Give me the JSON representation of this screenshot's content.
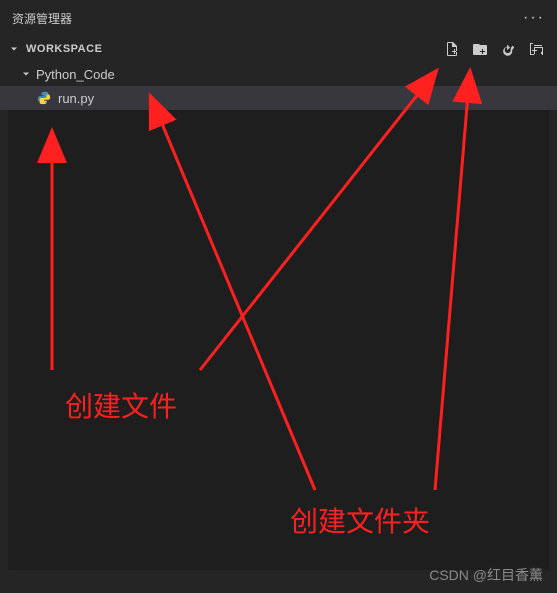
{
  "titleBar": {
    "title": "资源管理器",
    "moreLabel": "···"
  },
  "section": {
    "title": "WORKSPACE"
  },
  "tree": {
    "folder": {
      "name": "Python_Code"
    },
    "file": {
      "name": "run.py"
    }
  },
  "annotations": {
    "createFile": "创建文件",
    "createFolder": "创建文件夹"
  },
  "watermark": "CSDN @红目香薰"
}
